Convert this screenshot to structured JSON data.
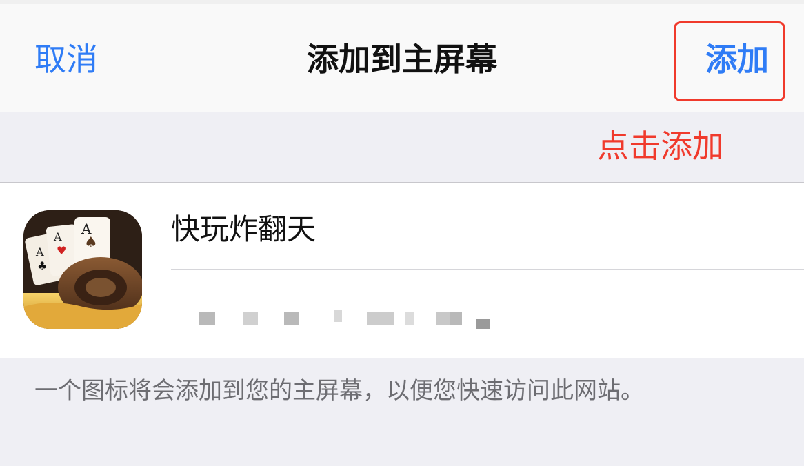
{
  "nav": {
    "cancel_label": "取消",
    "title": "添加到主屏幕",
    "add_label": "添加"
  },
  "annotation": {
    "hint_text": "点击添加",
    "highlight_color": "#f03a2c"
  },
  "app": {
    "name": "快玩炸翻天",
    "icon": "poker-game-app-icon"
  },
  "footer": {
    "description": "一个图标将会添加到您的主屏幕，以便您快速访问此网站。"
  },
  "colors": {
    "accent": "#2f7cf6",
    "background": "#efeff4"
  }
}
